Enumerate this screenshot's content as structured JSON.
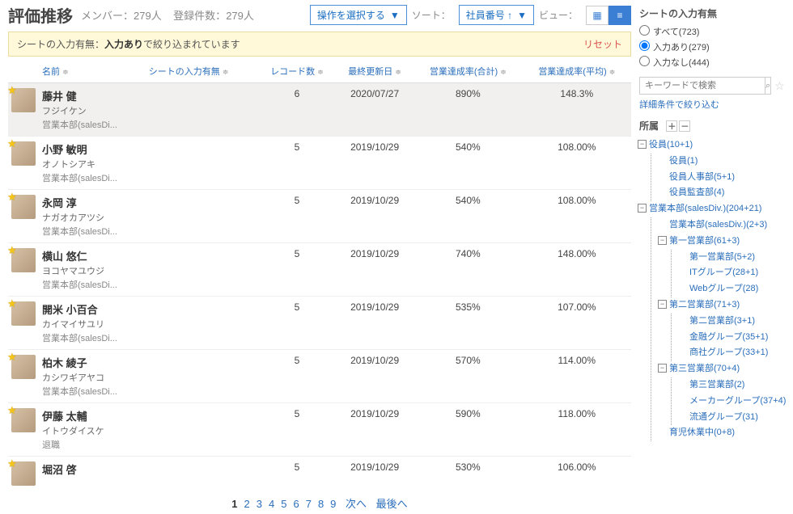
{
  "header": {
    "title": "評価推移",
    "member_label": "メンバー：",
    "member_count": "279人",
    "reg_label": "登録件数：",
    "reg_count": "279人",
    "op_select": "操作を選択する",
    "sort_label": "ソート：",
    "sort_value": "社員番号 ↑",
    "view_label": "ビュー："
  },
  "filterbar": {
    "prefix": "シートの入力有無：",
    "value": "入力あり",
    "suffix": " で絞り込まれています",
    "reset": "リセット"
  },
  "columns": {
    "name": "名前",
    "sheet": "シートの入力有無",
    "records": "レコード数",
    "updated": "最終更新日",
    "total": "営業達成率(合計)",
    "avg": "営業達成率(平均)"
  },
  "rows": [
    {
      "name": "藤井 健",
      "kana": "フジイケン",
      "dept": "営業本部(salesDi...",
      "records": "6",
      "updated": "2020/07/27",
      "total": "890%",
      "avg": "148.3%"
    },
    {
      "name": "小野 敏明",
      "kana": "オノトシアキ",
      "dept": "営業本部(salesDi...",
      "records": "5",
      "updated": "2019/10/29",
      "total": "540%",
      "avg": "108.00%"
    },
    {
      "name": "永岡 淳",
      "kana": "ナガオカアツシ",
      "dept": "営業本部(salesDi...",
      "records": "5",
      "updated": "2019/10/29",
      "total": "540%",
      "avg": "108.00%"
    },
    {
      "name": "横山 悠仁",
      "kana": "ヨコヤマユウジ",
      "dept": "営業本部(salesDi...",
      "records": "5",
      "updated": "2019/10/29",
      "total": "740%",
      "avg": "148.00%"
    },
    {
      "name": "開米 小百合",
      "kana": "カイマイサユリ",
      "dept": "営業本部(salesDi...",
      "records": "5",
      "updated": "2019/10/29",
      "total": "535%",
      "avg": "107.00%"
    },
    {
      "name": "柏木 綾子",
      "kana": "カシワギアヤコ",
      "dept": "営業本部(salesDi...",
      "records": "5",
      "updated": "2019/10/29",
      "total": "570%",
      "avg": "114.00%"
    },
    {
      "name": "伊藤 太輔",
      "kana": "イトウダイスケ",
      "dept": "退職",
      "records": "5",
      "updated": "2019/10/29",
      "total": "590%",
      "avg": "118.00%"
    },
    {
      "name": "堀沼 啓",
      "kana": "",
      "dept": "",
      "records": "5",
      "updated": "2019/10/29",
      "total": "530%",
      "avg": "106.00%"
    }
  ],
  "pager": {
    "pages": [
      "1",
      "2",
      "3",
      "4",
      "5",
      "6",
      "7",
      "8",
      "9"
    ],
    "next": "次へ",
    "last": "最後へ"
  },
  "side": {
    "filter_title": "シートの入力有無",
    "radios": [
      {
        "label": "すべて(723)",
        "checked": false
      },
      {
        "label": "入力あり(279)",
        "checked": true
      },
      {
        "label": "入力なし(444)",
        "checked": false
      }
    ],
    "search_placeholder": "キーワードで検索",
    "adv": "詳細条件で絞り込む",
    "org_title": "所属",
    "tree": [
      {
        "t": "役員(10+1)",
        "c": [
          {
            "t": "役員(1)"
          },
          {
            "t": "役員人事部(5+1)"
          },
          {
            "t": "役員監査部(4)"
          }
        ]
      },
      {
        "t": "営業本部(salesDiv.)(204+21)",
        "c": [
          {
            "t": "営業本部(salesDiv.)(2+3)"
          },
          {
            "t": "第一営業部(61+3)",
            "c": [
              {
                "t": "第一営業部(5+2)"
              },
              {
                "t": "ITグループ(28+1)"
              },
              {
                "t": "Webグループ(28)"
              }
            ]
          },
          {
            "t": "第二営業部(71+3)",
            "c": [
              {
                "t": "第二営業部(3+1)"
              },
              {
                "t": "金融グループ(35+1)"
              },
              {
                "t": "商社グループ(33+1)"
              }
            ]
          },
          {
            "t": "第三営業部(70+4)",
            "c": [
              {
                "t": "第三営業部(2)"
              },
              {
                "t": "メーカーグループ(37+4)"
              },
              {
                "t": "流通グループ(31)"
              }
            ]
          },
          {
            "t": "育児休業中(0+8)"
          }
        ]
      }
    ]
  }
}
